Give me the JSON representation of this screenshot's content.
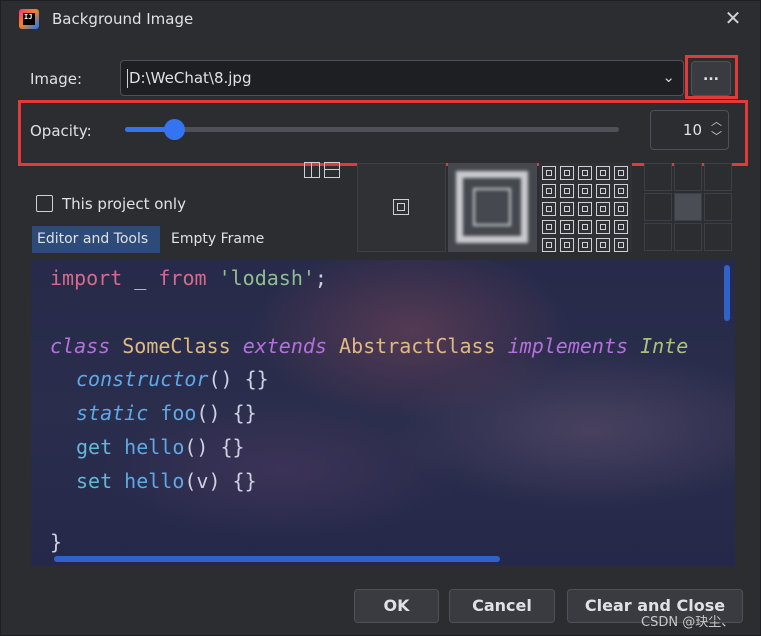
{
  "window": {
    "title": "Background Image",
    "close_icon": "close-icon"
  },
  "image": {
    "label": "Image:",
    "path": "D:\\WeChat\\8.jpg"
  },
  "browse": {
    "label": "..."
  },
  "opacity": {
    "label": "Opacity:",
    "value": "10",
    "slider_fraction": 0.1
  },
  "checkbox": {
    "label": "This project only",
    "checked": false
  },
  "tabs": [
    {
      "label": "Editor and Tools",
      "selected": true
    },
    {
      "label": "Empty Frame",
      "selected": false
    }
  ],
  "fill_options": [
    "center",
    "scale",
    "tile"
  ],
  "code_lines": {
    "l1": [
      "import",
      " _ ",
      "from",
      " ",
      "'lodash'",
      ";"
    ],
    "l3": [
      "class",
      " ",
      "SomeClass",
      " ",
      "extends",
      " ",
      "AbstractClass",
      " ",
      "implements",
      " ",
      "Inte"
    ],
    "l4": [
      "constructor",
      "() {}"
    ],
    "l5": [
      "static",
      " ",
      "foo",
      "() {}"
    ],
    "l6": [
      "get",
      " ",
      "hello",
      "() {}"
    ],
    "l7": [
      "set",
      " ",
      "hello",
      "(v) {}"
    ],
    "l9": "}"
  },
  "buttons": {
    "ok": "OK",
    "cancel": "Cancel",
    "clear_close": "Clear and Close"
  },
  "watermark": "CSDN @玦尘、",
  "colors": {
    "accent": "#3574f0",
    "highlight_box": "#e03a3a"
  }
}
